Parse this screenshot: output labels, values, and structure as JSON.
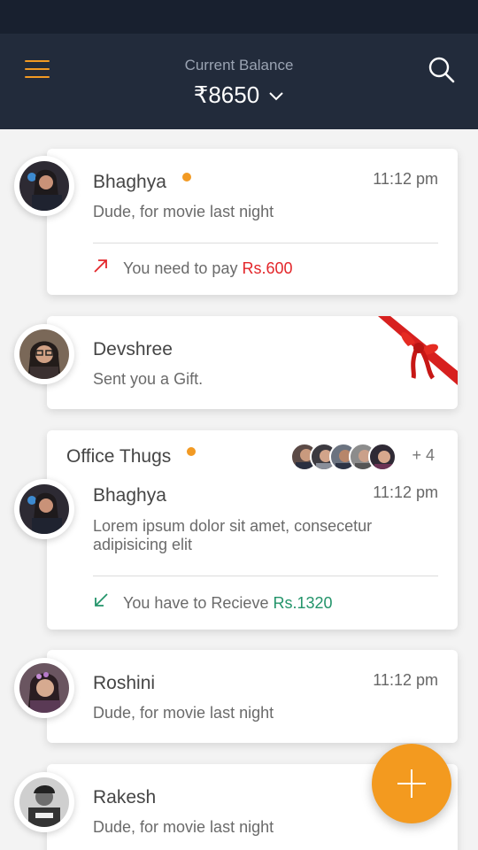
{
  "header": {
    "balance_label": "Current Balance",
    "balance_value": "₹8650",
    "menu_icon": "hamburger-menu-icon",
    "search_icon": "search-icon",
    "accent_color": "#f29a23"
  },
  "cards": [
    {
      "name": "Bhaghya",
      "unread_dot": true,
      "time": "11:12 pm",
      "message": "Dude, for movie last night",
      "pay_text": "You need to pay",
      "pay_amount": "Rs.600",
      "pay_direction": "outgoing"
    },
    {
      "name": "Devshree",
      "message": "Sent you a Gift.",
      "gift_icon": "gift-ribbon-icon"
    },
    {
      "group_name": "Office Thugs",
      "unread_dot": true,
      "more_members": "+ 4",
      "name": "Bhaghya",
      "time": "11:12 pm",
      "message_line1": "Lorem ipsum dolor sit amet, consecetur",
      "message_line2": "adipisicing elit",
      "pay_text": "You have to Recieve",
      "pay_amount": "Rs.1320",
      "pay_direction": "incoming"
    },
    {
      "name": "Roshini",
      "time": "11:12 pm",
      "message": "Dude, for movie last night"
    },
    {
      "name": "Rakesh",
      "message": "Dude, for movie last night"
    }
  ],
  "fab": {
    "icon": "plus-icon",
    "color": "#f39a1f"
  }
}
